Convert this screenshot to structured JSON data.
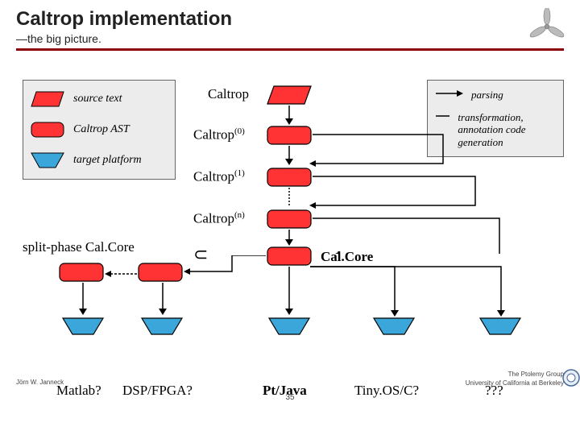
{
  "header": {
    "title": "Caltrop implementation",
    "subtitle": "—the big picture."
  },
  "legend": {
    "source_text": "source text",
    "caltrop_ast": "Caltrop AST",
    "target_platform": "target platform"
  },
  "right_legend": {
    "parsing": "parsing",
    "transform": "transformation, annotation code generation"
  },
  "stages": {
    "caltrop": "Caltrop",
    "caltrop0": "Caltrop",
    "caltrop0_sup": "(0)",
    "caltrop1": "Caltrop",
    "caltrop1_sup": "(1)",
    "caltropn": "Caltrop",
    "caltropn_sup": "(n)",
    "split": "split-phase Cal.Core",
    "subset": "⊂",
    "calcore": "Cal.Core"
  },
  "platforms": {
    "matlab": "Matlab?",
    "dsp": "DSP/FPGA?",
    "ptjava": "Pt/Java",
    "tinyos": "Tiny.OS/C?",
    "qqq": "???"
  },
  "footer": {
    "author": "Jörn W. Janneck",
    "group": "The Ptolemy Group",
    "uni": "University of California at Berkeley",
    "page": "35"
  }
}
